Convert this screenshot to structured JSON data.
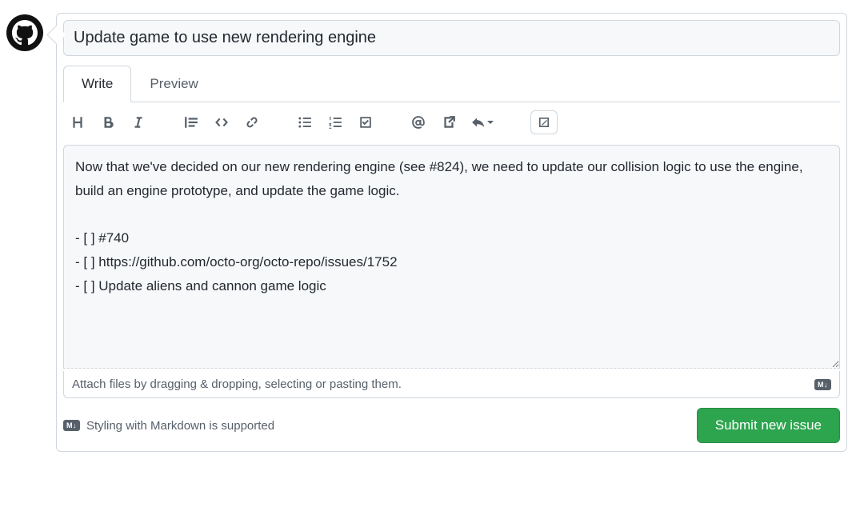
{
  "title": "Update game to use new rendering engine",
  "tabs": {
    "write": "Write",
    "preview": "Preview",
    "active": "write"
  },
  "body": "Now that we've decided on our new rendering engine (see #824), we need to update our collision logic to use the engine, build an engine prototype, and update the game logic.\n\n- [ ] #740\n- [ ] https://github.com/octo-org/octo-repo/issues/1752\n- [ ] Update aliens and cannon game logic",
  "attach_hint": "Attach files by dragging & dropping, selecting or pasting them.",
  "markdown_badge": "M↓",
  "markdown_hint": "Styling with Markdown is supported",
  "submit_label": "Submit new issue",
  "toolbar": {
    "heading_title": "Heading",
    "bold_title": "Bold",
    "italic_title": "Italic",
    "quote_title": "Quote",
    "code_title": "Code",
    "link_title": "Link",
    "ul_title": "Unordered list",
    "ol_title": "Numbered list",
    "task_title": "Task list",
    "mention_title": "Mention",
    "crossref_title": "Cross-reference",
    "reply_title": "Saved replies",
    "fullscreen_title": "Toggle fullscreen"
  }
}
